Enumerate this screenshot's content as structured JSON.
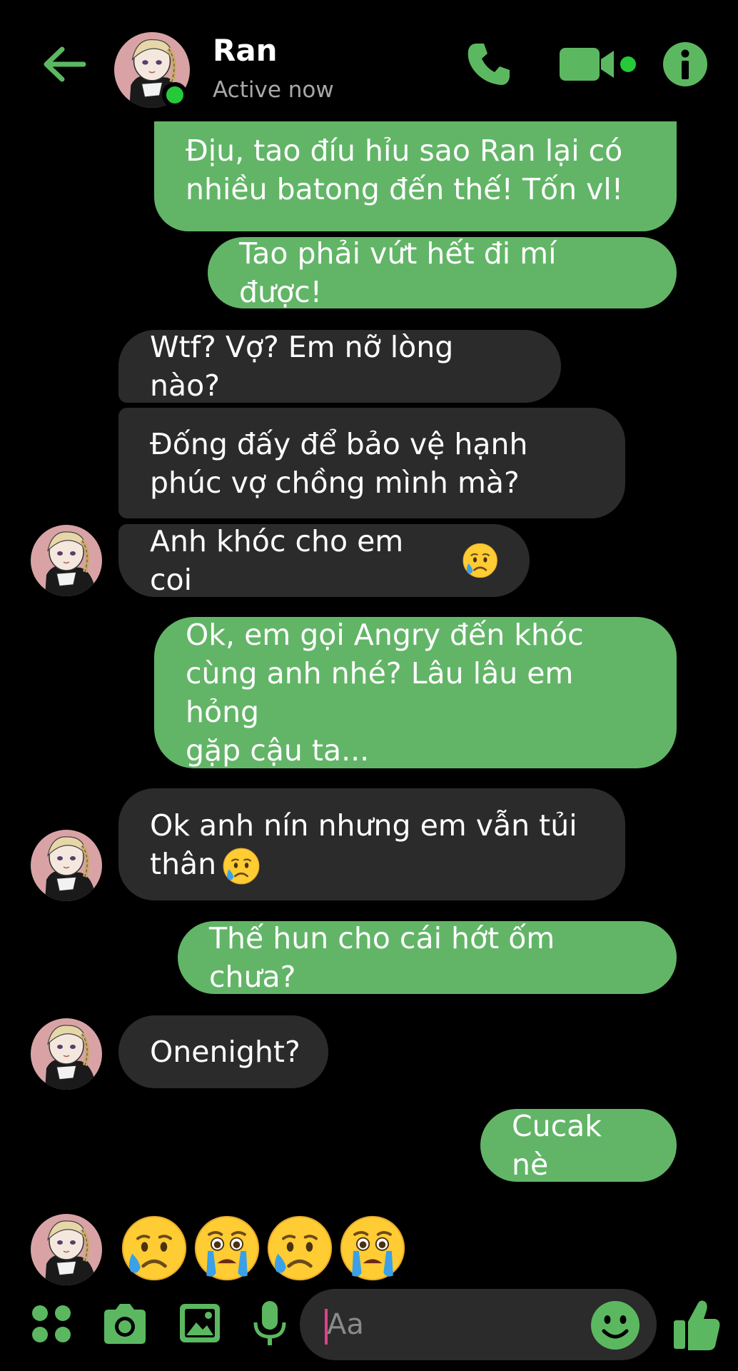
{
  "header": {
    "back_icon": "arrow-left-icon",
    "contact_name": "Ran",
    "status": "Active now",
    "call_icon": "phone-icon",
    "video_icon": "video-camera-icon",
    "info_icon": "info-icon",
    "accent_color": "#5cb860",
    "online_color": "#25c93a"
  },
  "messages": [
    {
      "from": "me",
      "text": "Địu, tao đíu hỉu sao Ran lại có\nnhiều batong đến thế! Tốn vl!"
    },
    {
      "from": "me",
      "text": "Tao phải vứt hết đi mí được!"
    },
    {
      "from": "them",
      "text": "Wtf? Vợ? Em nỡ lòng nào?"
    },
    {
      "from": "them",
      "text": "Đống đấy để bảo vệ hạnh\nphúc vợ chồng mình mà?"
    },
    {
      "from": "them",
      "text": "Anh khóc cho em coi",
      "emoji": "crying-face"
    },
    {
      "from": "me",
      "text": "Ok, em gọi Angry đến khóc\ncùng anh nhé? Lâu lâu em hỏng\ngặp cậu ta..."
    },
    {
      "from": "them",
      "text": "Ok anh nín nhưng em vẫn tủi\nthân",
      "emoji": "sad-but-relieved-face"
    },
    {
      "from": "me",
      "text": "Thế hun cho cái hớt ốm chưa?"
    },
    {
      "from": "them",
      "text": "Onenight?"
    },
    {
      "from": "me",
      "text": "Cucak nè"
    },
    {
      "from": "them",
      "emojis": [
        "sad-but-relieved-face",
        "loudly-crying-face",
        "sad-but-relieved-face",
        "loudly-crying-face"
      ]
    }
  ],
  "composer": {
    "apps_icon": "four-dots-icon",
    "camera_icon": "camera-icon",
    "gallery_icon": "image-icon",
    "mic_icon": "microphone-icon",
    "placeholder": "Aa",
    "emoji_icon": "smiley-icon",
    "like_icon": "thumbs-up-icon"
  },
  "colors": {
    "outgoing_bubble": "#62b567",
    "incoming_bubble": "#2b2b2b",
    "background": "#000000"
  }
}
